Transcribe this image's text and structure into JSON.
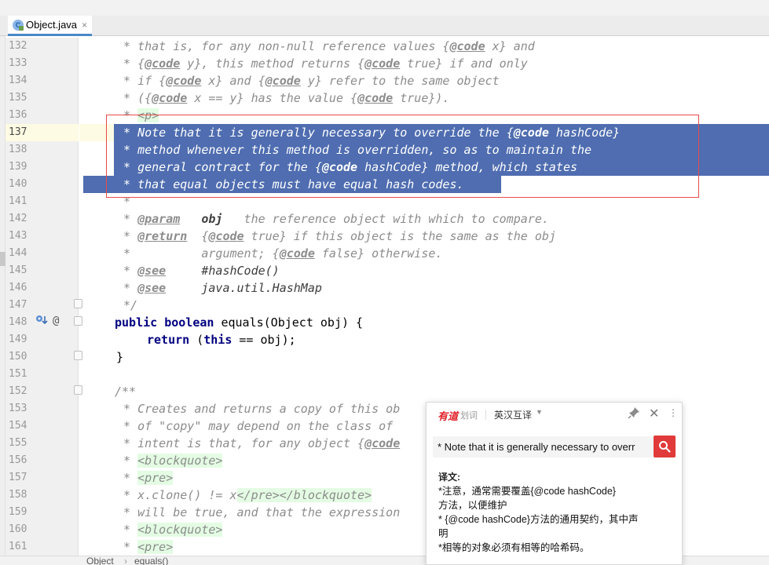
{
  "tab": {
    "file_name": "Object.java",
    "icon_letter": "C",
    "close_glyph": "×"
  },
  "gutter": {
    "line_numbers": [
      "132",
      "133",
      "134",
      "135",
      "136",
      "137",
      "138",
      "139",
      "140",
      "141",
      "142",
      "143",
      "144",
      "145",
      "146",
      "147",
      "148",
      "149",
      "150",
      "151",
      "152",
      "153",
      "154",
      "155",
      "156",
      "157",
      "158",
      "159",
      "160",
      "161"
    ],
    "current_line": "137",
    "method_marker": "@",
    "override_icon": "overridden-method-icon"
  },
  "code": {
    "l132": {
      "a": " * that is, for any non-null reference values {",
      "b": "@code",
      "c": " x} and"
    },
    "l133": {
      "a": " * {",
      "b": "@code",
      "c": " y}, this method returns {",
      "d": "@code",
      "e": " true} if and only"
    },
    "l134": {
      "a": " * if {",
      "b": "@code",
      "c": " x} and {",
      "d": "@code",
      "e": " y} refer to the same object"
    },
    "l135": {
      "a": " * ({",
      "b": "@code",
      "c": " x == y} has the value {",
      "d": "@code",
      "e": " true})."
    },
    "l136": {
      "a": " * ",
      "b": "<p>"
    },
    "l137": {
      "a": " * Note that it is generally necessary to override the {",
      "b": "@code",
      "c": " hashCode}"
    },
    "l138": " * method whenever this method is overridden, so as to maintain the",
    "l139": {
      "a": " * general contract for the {",
      "b": "@code",
      "c": " hashCode} method, which states"
    },
    "l140": " * that equal objects must have equal hash codes.",
    "l141": " *",
    "l142": {
      "a": " * ",
      "b": "@param",
      "c": "   ",
      "d": "obj",
      "e": "   the reference object with which to compare."
    },
    "l143": {
      "a": " * ",
      "b": "@return",
      "c": "  {",
      "d": "@code",
      "e": " true} if this object is the same as the obj"
    },
    "l144": {
      "a": " *          argument; {",
      "b": "@code",
      "c": " false} otherwise."
    },
    "l145": {
      "a": " * ",
      "b": "@see",
      "c": "     ",
      "d": "#hashCode()"
    },
    "l146": {
      "a": " * ",
      "b": "@see",
      "c": "     ",
      "d": "java.util.HashMap"
    },
    "l147": " */",
    "l148": {
      "k1": "public",
      "k2": "boolean",
      "rest": " equals(Object obj) {"
    },
    "l149": {
      "k1": "return",
      "a": " (",
      "k2": "this",
      "rest": " == obj);"
    },
    "l150": "}",
    "l152": "/**",
    "l153": " * Creates and returns a copy of this ob",
    "l154": " * of \"copy\" may depend on the class of",
    "l155": {
      "a": " * intent is that, for any object {",
      "b": "@code"
    },
    "l156": {
      "a": " * ",
      "b": "<blockquote>"
    },
    "l157": {
      "a": " * ",
      "b": "<pre>"
    },
    "l158": {
      "a": " * x.clone() != x",
      "b": "</pre></blockquote>"
    },
    "l159": " * will be true, and that the expression",
    "l160": {
      "a": " * ",
      "b": "<blockquote>"
    },
    "l161": {
      "a": " * ",
      "b": "<pre>"
    }
  },
  "breadcrumb": {
    "class": "Object",
    "separator": "›",
    "method": "equals()"
  },
  "popup": {
    "brand": "有道",
    "brand_sub": "划词",
    "mode": "英汉互译",
    "mode_caret": "▼",
    "close_glyph": "✕",
    "more_glyph": "⋮",
    "query": "* Note that it is generally necessary to overr",
    "translation_label": "译文:",
    "translation_lines": [
      "*注意，通常需要覆盖{@code hashCode}",
      "方法，以便维护",
      "* {@code hashCode}方法的通用契约，其中声",
      "明",
      "*相等的对象必须有相等的哈希码。"
    ],
    "icons": {
      "pin": "pin-icon",
      "search": "search-icon"
    },
    "accent_color": "#e03a3a"
  },
  "colors": {
    "selection": "#4f6db0",
    "current_line": "#fdfbe3",
    "highlight_box": "#e84a4a"
  }
}
